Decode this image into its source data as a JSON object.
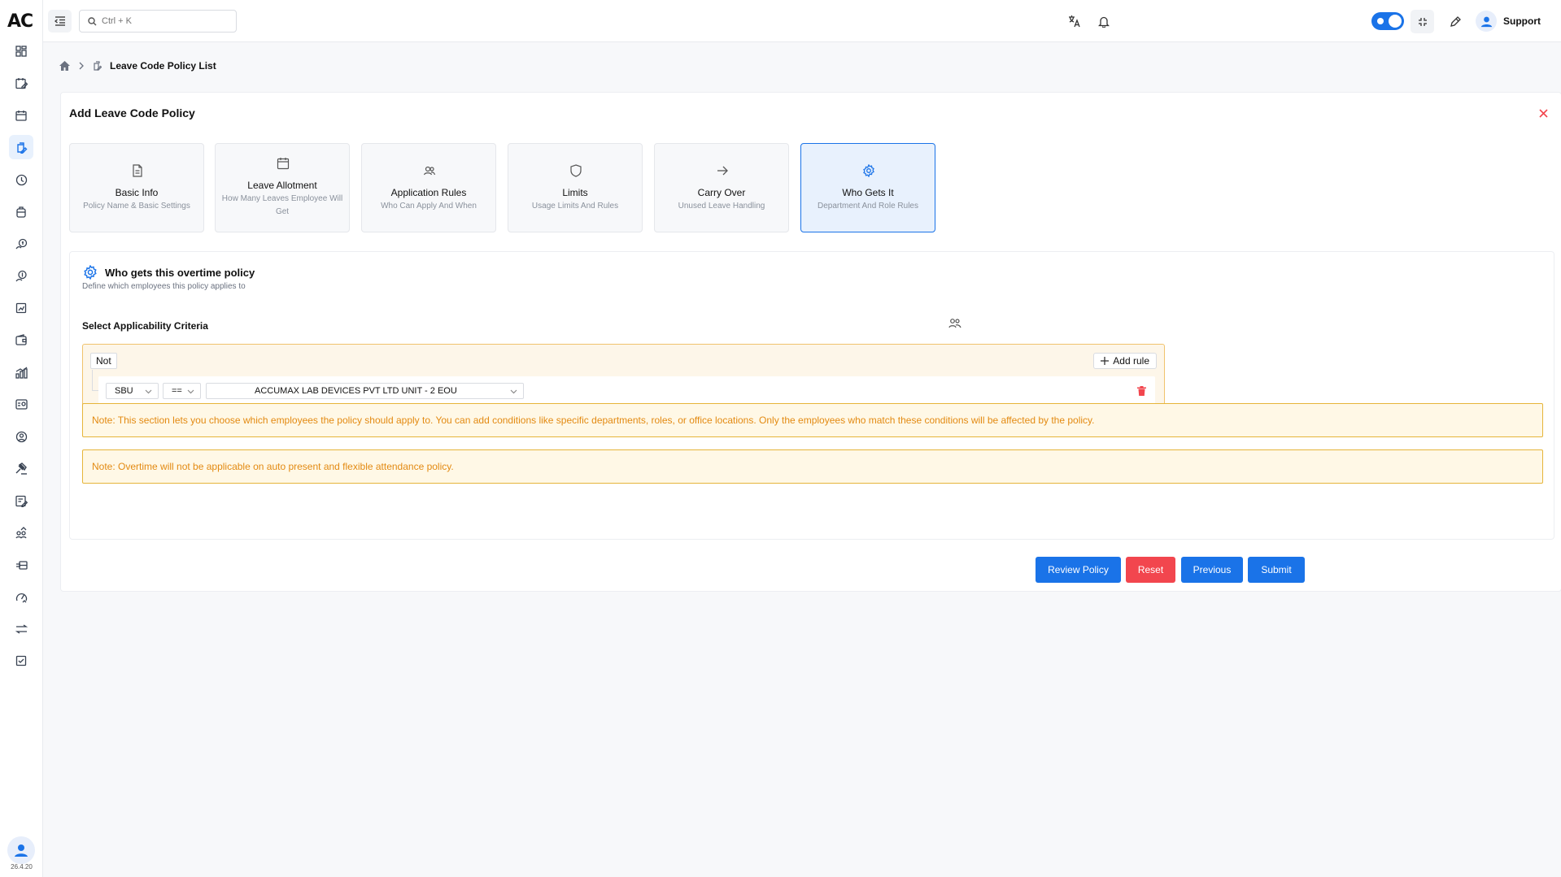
{
  "app": {
    "logo": "AC",
    "version": "26.4.20"
  },
  "sidebar": {
    "items": [
      {
        "icon": "dashboard-icon"
      },
      {
        "icon": "calendar-edit-icon"
      },
      {
        "icon": "calendar-icon"
      },
      {
        "icon": "leave-policy-icon",
        "active": true
      },
      {
        "icon": "clock-history-icon"
      },
      {
        "icon": "briefcase-icon"
      },
      {
        "icon": "money-hand-icon"
      },
      {
        "icon": "payroll-icon"
      },
      {
        "icon": "report-icon"
      },
      {
        "icon": "wallet-icon"
      },
      {
        "icon": "chart-icon"
      },
      {
        "icon": "id-card-icon"
      },
      {
        "icon": "user-circle-icon"
      },
      {
        "icon": "gavel-icon"
      },
      {
        "icon": "form-edit-icon"
      },
      {
        "icon": "team-growth-icon"
      },
      {
        "icon": "transfer-card-icon"
      },
      {
        "icon": "performance-icon"
      },
      {
        "icon": "swap-icon"
      },
      {
        "icon": "document-list-icon"
      }
    ]
  },
  "topbar": {
    "search_placeholder": "Ctrl + K",
    "user_name": "Support"
  },
  "breadcrumb": {
    "current": "Leave Code Policy List"
  },
  "form": {
    "title": "Add Leave Code Policy",
    "steps": [
      {
        "label": "Basic Info",
        "sub": "Policy Name & Basic Settings"
      },
      {
        "label": "Leave Allotment",
        "sub": "How Many Leaves Employee Will Get"
      },
      {
        "label": "Application Rules",
        "sub": "Who Can Apply And When"
      },
      {
        "label": "Limits",
        "sub": "Usage Limits And Rules"
      },
      {
        "label": "Carry Over",
        "sub": "Unused Leave Handling"
      },
      {
        "label": "Who Gets It",
        "sub": "Department And Role Rules",
        "active": true
      }
    ],
    "section": {
      "title": "Who gets this overtime policy",
      "subtitle": "Define which employees this policy applies to",
      "criteria_label": "Select Applicability Criteria",
      "not_label": "Not",
      "add_rule_label": "Add rule",
      "rule": {
        "field": "SBU",
        "operator": "==",
        "value": "ACCUMAX LAB DEVICES PVT LTD UNIT - 2 EOU"
      },
      "note1": "Note: This section lets you choose which employees the policy should apply to. You can add conditions like specific departments, roles, or office locations. Only the employees who match these conditions will be affected by the policy.",
      "note2": "Note: Overtime will not be applicable on auto present and flexible attendance policy."
    },
    "actions": {
      "review": "Review Policy",
      "reset": "Reset",
      "previous": "Previous",
      "submit": "Submit"
    }
  },
  "colors": {
    "primary": "#1a73e8",
    "danger": "#f2464e",
    "note_text": "#e38a12",
    "note_border": "#e6b53a"
  }
}
